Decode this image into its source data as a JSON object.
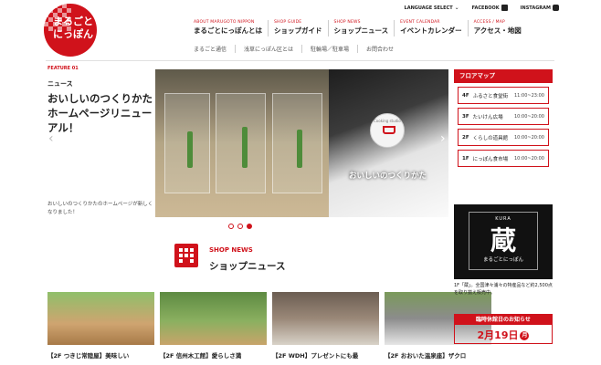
{
  "logo": {
    "line1": "まるごと",
    "line2": "にっぽん"
  },
  "topbar": {
    "language": "LANGUAGE SELECT",
    "facebook": "FACEBOOK",
    "instagram": "INSTAGRAM"
  },
  "gnav": [
    {
      "en": "ABOUT MARUGOTO NIPPON",
      "jp": "まるごとにっぽんとは"
    },
    {
      "en": "SHOP GUIDE",
      "jp": "ショップガイド"
    },
    {
      "en": "SHOP NEWS",
      "jp": "ショップニュース"
    },
    {
      "en": "EVENT CALENDAR",
      "jp": "イベントカレンダー"
    },
    {
      "en": "ACCESS / MAP",
      "jp": "アクセス・地図"
    }
  ],
  "subnav": [
    "まるごと通信",
    "浅草にっぽん区とは",
    "駐輪場／駐車場",
    "お問合わせ"
  ],
  "feature": {
    "label": "FEATURE 01",
    "category": "ニュース",
    "title": "おいしいのつくりかた ホームページリニューアル！",
    "desc": "おいしいのつくりかたのホームページが新しくなりました！"
  },
  "hero": {
    "caption": "おいしいのつくりかた",
    "card_text": "Cooking studio",
    "prev": "‹",
    "next": "›"
  },
  "shop_news": {
    "en": "SHOP NEWS",
    "jp": "ショップニュース"
  },
  "cards": [
    {
      "title": "【2F つきじ常陸屋】美味しい",
      "color": "#cfa470"
    },
    {
      "title": "【2F 信州木工館】愛らしさ満",
      "color": "#5d8a42"
    },
    {
      "title": "【2F WDH】プレゼントにも最",
      "color": "#9a8878"
    },
    {
      "title": "【2F おおいた温泉座】ザクロ",
      "color": "#8c8c8c"
    }
  ],
  "floor_map": {
    "title": "フロアマップ",
    "floors": [
      {
        "floor": "4F",
        "name": "ふるさと食堂街",
        "hours": "11:00~23:00"
      },
      {
        "floor": "3F",
        "name": "たいけん広場",
        "hours": "10:00~20:00"
      },
      {
        "floor": "2F",
        "name": "くらしの道具館",
        "hours": "10:00~20:00"
      },
      {
        "floor": "1F",
        "name": "にっぽん食市場",
        "hours": "10:00~20:00"
      }
    ]
  },
  "kura": {
    "label": "KURA",
    "kanji": "蔵",
    "sub": "まるごとにっぽん",
    "desc": "1F「蔵」。全国津々浦々の特産品など約2,500点を取り揃え販売中。"
  },
  "closed": {
    "title": "臨時休館日のお知らせ",
    "date": "2月19日",
    "weekday": "月"
  },
  "colors": {
    "accent": "#d0121b"
  }
}
